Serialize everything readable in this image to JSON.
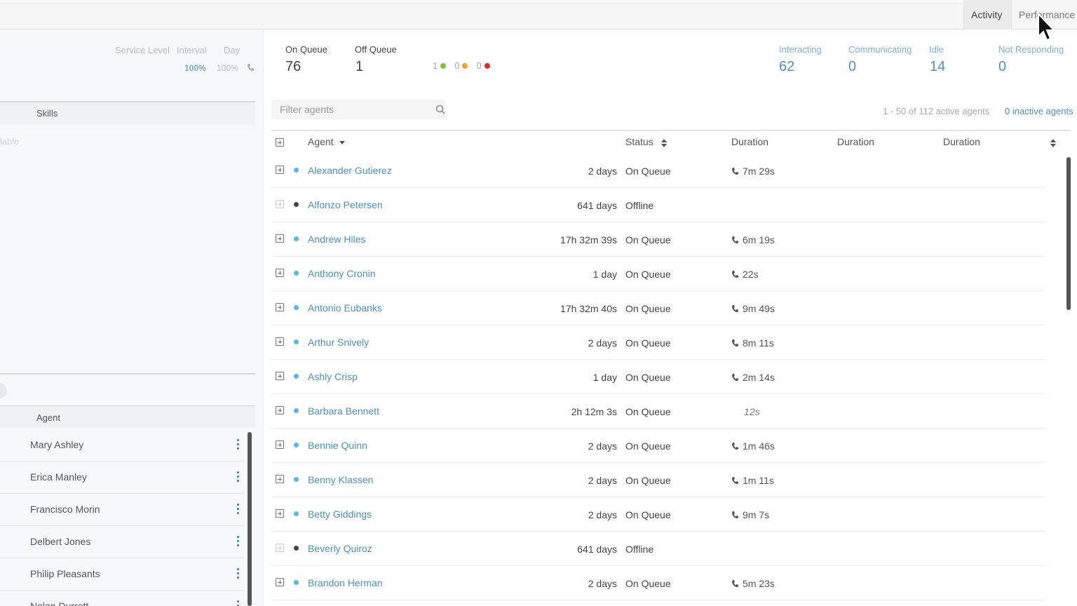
{
  "header": {
    "tabs": [
      {
        "label": "Activity",
        "active": true
      },
      {
        "label": "Performance",
        "active": false
      }
    ]
  },
  "left_panel": {
    "service_level": {
      "headers": [
        "Service Level",
        "Interval",
        "Day"
      ],
      "values": [
        "100%",
        "100%"
      ]
    },
    "skills_label": "Skills",
    "faint_text": "lable",
    "agent_label": "Agent",
    "agents": [
      "Mary Ashley",
      "Erica Manley",
      "Francisco Morin",
      "Delbert Jones",
      "Philip Pleasants",
      "Nolan Durrett"
    ]
  },
  "summary": {
    "on_queue": {
      "label": "On Queue",
      "value": "76"
    },
    "off_queue": {
      "label": "Off Queue",
      "value": "1"
    },
    "status_counts": [
      {
        "value": "1",
        "color": "#7cc242"
      },
      {
        "value": "0",
        "color": "#f0a030"
      },
      {
        "value": "0",
        "color": "#e02a2a"
      }
    ],
    "interacting": {
      "label": "Interacting",
      "value": "62"
    },
    "communicating": {
      "label": "Communicating",
      "value": "0"
    },
    "idle": {
      "label": "Idle",
      "value": "14"
    },
    "not_responding": {
      "label": "Not Responding",
      "value": "0"
    }
  },
  "filter": {
    "placeholder": "Filter agents"
  },
  "paging": {
    "text": "1 - 50 of 112 active agents",
    "inactive": "0 inactive agents"
  },
  "table": {
    "headers": {
      "agent": "Agent",
      "status": "Status",
      "duration1": "Duration",
      "duration2": "Duration",
      "duration3": "Duration"
    },
    "rows": [
      {
        "name": "Alexander Gutierez",
        "duration": "2 days",
        "status": "On Queue",
        "call": "7m 29s",
        "online": true,
        "phone": true
      },
      {
        "name": "Alfonzo Petersen",
        "duration": "641 days",
        "status": "Offline",
        "call": "",
        "online": false,
        "phone": false
      },
      {
        "name": "Andrew Hiles",
        "duration": "17h 32m 39s",
        "status": "On Queue",
        "call": "6m 19s",
        "online": true,
        "phone": true
      },
      {
        "name": "Anthony Cronin",
        "duration": "1 day",
        "status": "On Queue",
        "call": "22s",
        "online": true,
        "phone": true
      },
      {
        "name": "Antonio Eubanks",
        "duration": "17h 32m 40s",
        "status": "On Queue",
        "call": "9m 49s",
        "online": true,
        "phone": true
      },
      {
        "name": "Arthur Snively",
        "duration": "2 days",
        "status": "On Queue",
        "call": "8m 11s",
        "online": true,
        "phone": true
      },
      {
        "name": "Ashly Crisp",
        "duration": "1 day",
        "status": "On Queue",
        "call": "2m 14s",
        "online": true,
        "phone": true
      },
      {
        "name": "Barbara Bennett",
        "duration": "2h 12m 3s",
        "status": "On Queue",
        "call": "12s",
        "online": true,
        "phone": false
      },
      {
        "name": "Bennie Quinn",
        "duration": "2 days",
        "status": "On Queue",
        "call": "1m 46s",
        "online": true,
        "phone": true
      },
      {
        "name": "Benny Klassen",
        "duration": "2 days",
        "status": "On Queue",
        "call": "1m 11s",
        "online": true,
        "phone": true
      },
      {
        "name": "Betty Giddings",
        "duration": "2 days",
        "status": "On Queue",
        "call": "9m 7s",
        "online": true,
        "phone": true
      },
      {
        "name": "Beverly Quiroz",
        "duration": "641 days",
        "status": "Offline",
        "call": "",
        "online": false,
        "phone": false
      },
      {
        "name": "Brandon Herman",
        "duration": "2 days",
        "status": "On Queue",
        "call": "5m 23s",
        "online": true,
        "phone": true
      }
    ]
  }
}
